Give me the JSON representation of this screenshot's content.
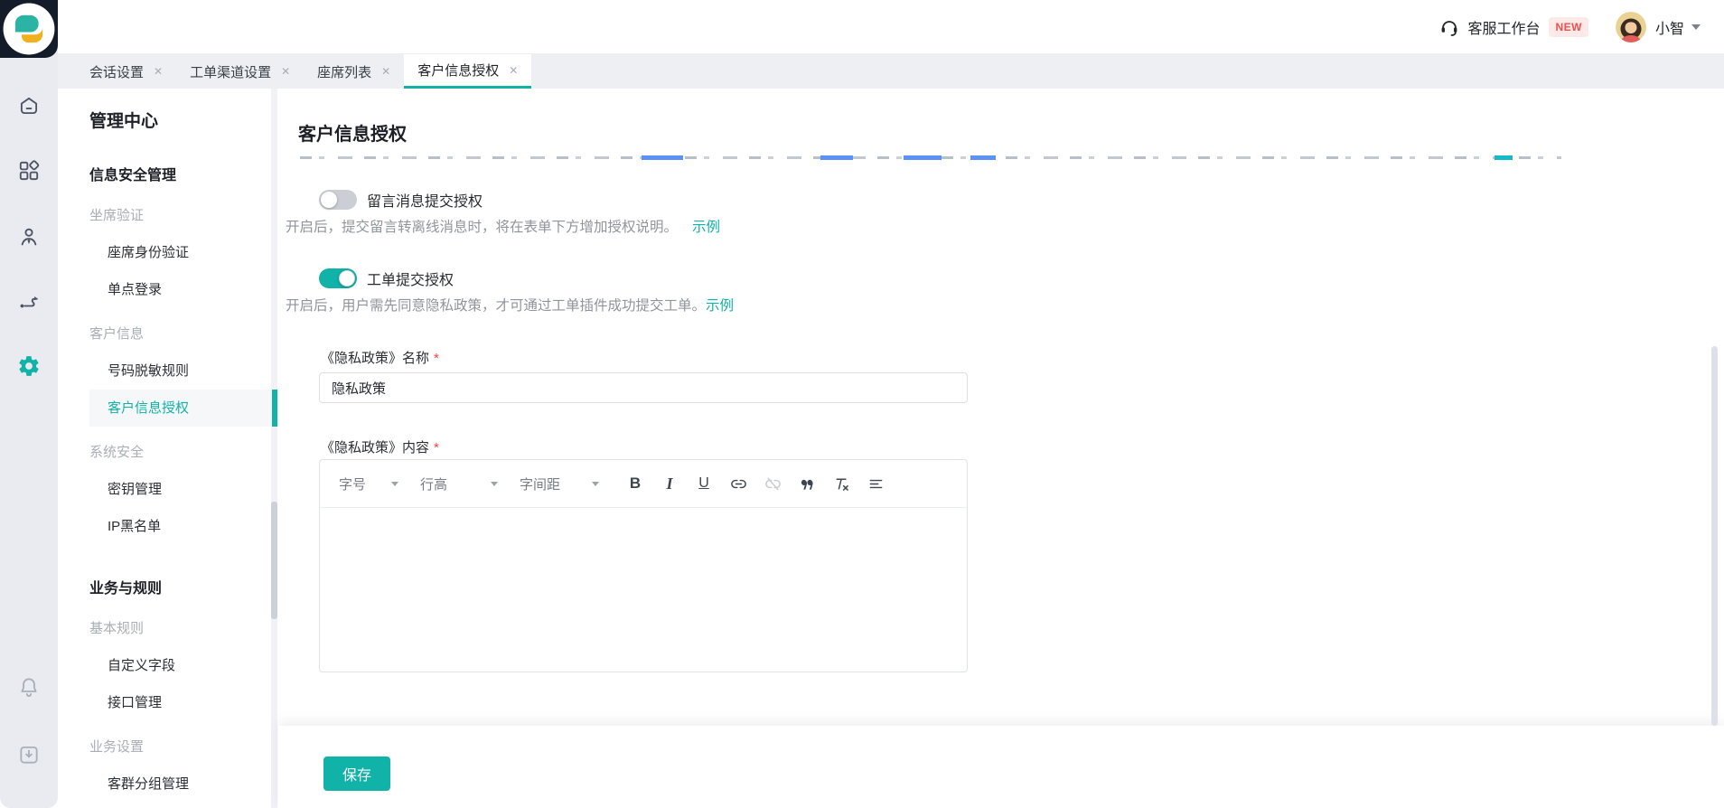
{
  "colors": {
    "accent": "#11b2a8",
    "badge_red": "#f34f4a",
    "badge_bg": "#fde9e8",
    "rail_dark": "#141b29"
  },
  "header": {
    "workbench_label": "客服工作台",
    "new_badge": "NEW",
    "username": "小智"
  },
  "tabs": {
    "close_glyph": "✕",
    "items": [
      {
        "label": "会话设置"
      },
      {
        "label": "工单渠道设置"
      },
      {
        "label": "座席列表"
      },
      {
        "label": "客户信息授权",
        "active": true
      }
    ]
  },
  "rail": {
    "icons": [
      "home",
      "apps",
      "agent",
      "workflow",
      "settings",
      "notifications",
      "download"
    ],
    "active_icon": "settings"
  },
  "sidebar": {
    "title": "管理中心",
    "sections": [
      {
        "header": "信息安全管理",
        "groups": [
          {
            "label": "坐席验证",
            "items": [
              {
                "label": "座席身份验证"
              },
              {
                "label": "单点登录"
              }
            ]
          },
          {
            "label": "客户信息",
            "items": [
              {
                "label": "号码脱敏规则"
              },
              {
                "label": "客户信息授权",
                "active": true
              }
            ]
          },
          {
            "label": "系统安全",
            "items": [
              {
                "label": "密钥管理"
              },
              {
                "label": "IP黑名单"
              }
            ]
          }
        ]
      },
      {
        "header": "业务与规则",
        "groups": [
          {
            "label": "基本规则",
            "items": [
              {
                "label": "自定义字段"
              },
              {
                "label": "接口管理"
              }
            ]
          },
          {
            "label": "业务设置",
            "items": [
              {
                "label": "客群分组管理"
              }
            ]
          }
        ]
      }
    ]
  },
  "main": {
    "title": "客户信息授权",
    "toggles": [
      {
        "on": false,
        "label": "留言消息提交授权",
        "desc": "开启后，提交留言转离线消息时，将在表单下方增加授权说明。",
        "link": "示例"
      },
      {
        "on": true,
        "label": "工单提交授权",
        "desc": "开启后，用户需先同意隐私政策，才可通过工单插件成功提交工单。",
        "link": "示例"
      }
    ],
    "form": {
      "name_label": "《隐私政策》名称",
      "name_value": "隐私政策",
      "content_label": "《隐私政策》内容",
      "required_mark": "*",
      "toolbar": {
        "font_size_label": "字号",
        "line_height_label": "行高",
        "letter_spacing_label": "字间距",
        "bold_label": "B",
        "italic_label": "I",
        "underline_label": "U",
        "icons": [
          "link",
          "unlink",
          "quote",
          "clear-format",
          "align-left"
        ]
      }
    },
    "save_button": "保存"
  }
}
